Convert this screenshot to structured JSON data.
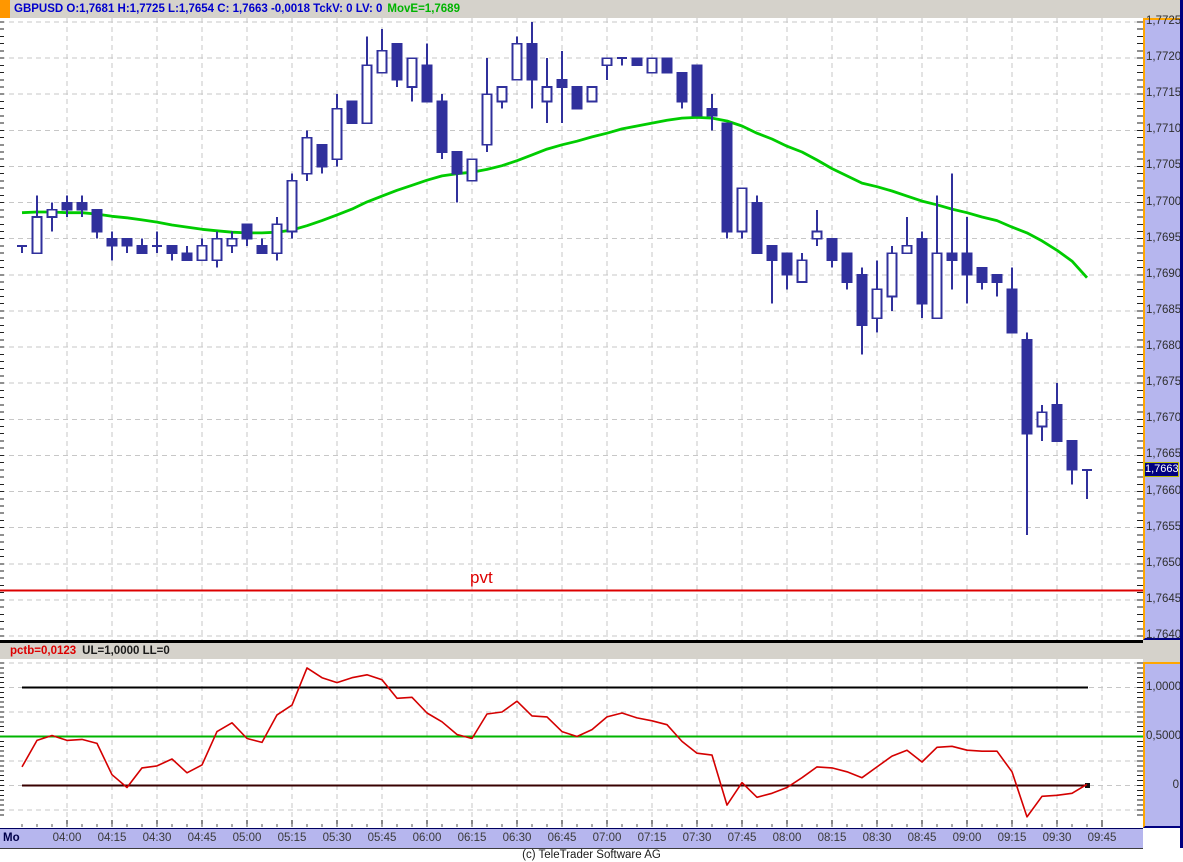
{
  "header": {
    "symbol_info": "GBPUSD O:1,7681 H:1,7725 L:1,7654 C: 1,7663 -0,0018 TckV: 0 LV: 0",
    "ma_info": "MovE=1,7689"
  },
  "price_axis": {
    "labels": [
      "1,7725",
      "1,7720",
      "1,7715",
      "1,7710",
      "1,7705",
      "1,7700",
      "1,7695",
      "1,7690",
      "1,7685",
      "1,7680",
      "1,7675",
      "1,7670",
      "1,7665",
      "1,7660",
      "1,7655",
      "1,7650",
      "1,7645",
      "1,7640"
    ],
    "current_price_tag": "1,7663"
  },
  "indicator": {
    "header_value": "pctb=0,0123",
    "header_params": "UL=1,0000 LL=0",
    "axis_labels": [
      "1,0000",
      "0,5000",
      "0"
    ],
    "axis_values": [
      1.0,
      0.5,
      0.0
    ]
  },
  "pvt_label": "pvt",
  "time_axis": {
    "day_label": "Mo",
    "labels": [
      "04:00",
      "04:15",
      "04:30",
      "04:45",
      "05:00",
      "05:15",
      "05:30",
      "05:45",
      "06:00",
      "06:15",
      "06:30",
      "06:45",
      "07:00",
      "07:15",
      "07:30",
      "07:45",
      "08:00",
      "08:15",
      "08:30",
      "08:45",
      "09:00",
      "09:15",
      "09:30",
      "09:45"
    ]
  },
  "footer": {
    "copyright": "(c) TeleTrader Software AG"
  },
  "colors": {
    "header_bg": "#d5d2cb",
    "header_text": "#0000cc",
    "ma_text": "#00b400",
    "axis_bg": "#b6b6ee",
    "axis_border_orange": "#ffa600",
    "window_border": "#000080",
    "grid": "#c7c7c7",
    "candle": "#30309c",
    "candle_up_fill": "#ffffff",
    "ma_line": "#00cc00",
    "pvt_line": "#dd0000",
    "oscillator": "#d40000",
    "upper_level": "#000000",
    "mid_level": "#00b400",
    "lower_level": "#380000",
    "price_tag_bg": "#000080",
    "price_tag_border": "#b8b800",
    "tick": "#222222"
  },
  "chart_data": [
    {
      "type": "candlestick",
      "title": "GBPUSD 5-minute candles with moving average (MovE) and pivot line",
      "ylim": [
        1.764,
        1.7727
      ],
      "y_tick_step": 0.0005,
      "grid": "dashed",
      "x": [
        "03:45",
        "03:50",
        "03:55",
        "04:00",
        "04:05",
        "04:10",
        "04:15",
        "04:20",
        "04:25",
        "04:30",
        "04:35",
        "04:40",
        "04:45",
        "04:50",
        "04:55",
        "05:00",
        "05:05",
        "05:10",
        "05:15",
        "05:20",
        "05:25",
        "05:30",
        "05:35",
        "05:40",
        "05:45",
        "05:50",
        "05:55",
        "06:00",
        "06:05",
        "06:10",
        "06:15",
        "06:20",
        "06:25",
        "06:30",
        "06:35",
        "06:40",
        "06:45",
        "06:50",
        "06:55",
        "07:00",
        "07:05",
        "07:10",
        "07:15",
        "07:20",
        "07:25",
        "07:30",
        "07:35",
        "07:40",
        "07:45",
        "07:50",
        "07:55",
        "08:00",
        "08:05",
        "08:10",
        "08:15",
        "08:20",
        "08:25",
        "08:30",
        "08:35",
        "08:40",
        "08:45",
        "08:50",
        "08:55",
        "09:00",
        "09:05",
        "09:10",
        "09:15",
        "09:20",
        "09:25",
        "09:30",
        "09:35",
        "09:40"
      ],
      "ohlc": [
        [
          1.7694,
          1.7694,
          1.7693,
          1.7694
        ],
        [
          1.7693,
          1.7701,
          1.7693,
          1.7698
        ],
        [
          1.7698,
          1.77,
          1.7696,
          1.7699
        ],
        [
          1.77,
          1.7701,
          1.7698,
          1.7699
        ],
        [
          1.77,
          1.7701,
          1.7698,
          1.7699
        ],
        [
          1.7699,
          1.7699,
          1.7695,
          1.7696
        ],
        [
          1.7695,
          1.7696,
          1.7692,
          1.7694
        ],
        [
          1.7695,
          1.7695,
          1.7693,
          1.7694
        ],
        [
          1.7694,
          1.7695,
          1.7693,
          1.7693
        ],
        [
          1.7694,
          1.7696,
          1.7693,
          1.7694
        ],
        [
          1.7694,
          1.7694,
          1.7692,
          1.7693
        ],
        [
          1.7693,
          1.7694,
          1.7692,
          1.7692
        ],
        [
          1.7692,
          1.7695,
          1.7692,
          1.7694
        ],
        [
          1.7692,
          1.7696,
          1.7691,
          1.7695
        ],
        [
          1.7694,
          1.7696,
          1.7693,
          1.7695
        ],
        [
          1.7697,
          1.7697,
          1.7694,
          1.7695
        ],
        [
          1.7694,
          1.7695,
          1.7693,
          1.7693
        ],
        [
          1.7693,
          1.7698,
          1.7692,
          1.7697
        ],
        [
          1.7696,
          1.7704,
          1.7695,
          1.7703
        ],
        [
          1.7704,
          1.771,
          1.7703,
          1.7709
        ],
        [
          1.7708,
          1.7708,
          1.7704,
          1.7705
        ],
        [
          1.7706,
          1.7715,
          1.7705,
          1.7713
        ],
        [
          1.7714,
          1.7714,
          1.7711,
          1.7711
        ],
        [
          1.7711,
          1.7723,
          1.7711,
          1.7719
        ],
        [
          1.7718,
          1.7724,
          1.7718,
          1.7721
        ],
        [
          1.7722,
          1.7722,
          1.7716,
          1.7717
        ],
        [
          1.7716,
          1.772,
          1.7714,
          1.772
        ],
        [
          1.7719,
          1.7722,
          1.7714,
          1.7714
        ],
        [
          1.7714,
          1.7715,
          1.7706,
          1.7707
        ],
        [
          1.7707,
          1.7707,
          1.77,
          1.7704
        ],
        [
          1.7703,
          1.7706,
          1.7703,
          1.7706
        ],
        [
          1.7708,
          1.772,
          1.7707,
          1.7715
        ],
        [
          1.7714,
          1.7716,
          1.7713,
          1.7716
        ],
        [
          1.7717,
          1.7723,
          1.7717,
          1.7722
        ],
        [
          1.7722,
          1.7725,
          1.7713,
          1.7717
        ],
        [
          1.7714,
          1.772,
          1.7711,
          1.7716
        ],
        [
          1.7717,
          1.7721,
          1.7711,
          1.7716
        ],
        [
          1.7716,
          1.7716,
          1.7713,
          1.7713
        ],
        [
          1.7714,
          1.7716,
          1.7714,
          1.7716
        ],
        [
          1.7719,
          1.772,
          1.7717,
          1.772
        ],
        [
          1.772,
          1.772,
          1.7719,
          1.772
        ],
        [
          1.772,
          1.772,
          1.7719,
          1.7719
        ],
        [
          1.7718,
          1.772,
          1.7718,
          1.772
        ],
        [
          1.772,
          1.772,
          1.7718,
          1.7718
        ],
        [
          1.7718,
          1.7718,
          1.7713,
          1.7714
        ],
        [
          1.7719,
          1.7719,
          1.7712,
          1.7712
        ],
        [
          1.7713,
          1.7715,
          1.771,
          1.7712
        ],
        [
          1.7711,
          1.7711,
          1.7695,
          1.7696
        ],
        [
          1.7696,
          1.7702,
          1.7695,
          1.7702
        ],
        [
          1.77,
          1.7701,
          1.7693,
          1.7693
        ],
        [
          1.7694,
          1.7694,
          1.7686,
          1.7692
        ],
        [
          1.7693,
          1.7693,
          1.7688,
          1.769
        ],
        [
          1.7689,
          1.7693,
          1.7689,
          1.7692
        ],
        [
          1.7695,
          1.7699,
          1.7694,
          1.7696
        ],
        [
          1.7695,
          1.7695,
          1.7691,
          1.7692
        ],
        [
          1.7693,
          1.7693,
          1.7688,
          1.7689
        ],
        [
          1.769,
          1.7691,
          1.7679,
          1.7683
        ],
        [
          1.7684,
          1.7692,
          1.7682,
          1.7688
        ],
        [
          1.7687,
          1.7694,
          1.7685,
          1.7693
        ],
        [
          1.7693,
          1.7698,
          1.7693,
          1.7694
        ],
        [
          1.7695,
          1.7696,
          1.7684,
          1.7686
        ],
        [
          1.7684,
          1.7701,
          1.7684,
          1.7693
        ],
        [
          1.7693,
          1.7704,
          1.7688,
          1.7692
        ],
        [
          1.7693,
          1.7698,
          1.7686,
          1.769
        ],
        [
          1.7691,
          1.7691,
          1.7688,
          1.7689
        ],
        [
          1.769,
          1.769,
          1.7687,
          1.7689
        ],
        [
          1.7688,
          1.7691,
          1.7682,
          1.7682
        ],
        [
          1.7681,
          1.7682,
          1.7654,
          1.7668
        ],
        [
          1.7669,
          1.7672,
          1.7667,
          1.7671
        ],
        [
          1.7672,
          1.7675,
          1.7667,
          1.7667
        ],
        [
          1.7667,
          1.7667,
          1.7661,
          1.7663
        ],
        [
          1.7663,
          1.7663,
          1.7659,
          1.7663
        ]
      ],
      "overlays": [
        {
          "name": "MovE",
          "type": "line",
          "color": "#00cc00",
          "last_value_label": "1,7689",
          "values": [
            1.76986,
            1.76987,
            1.76987,
            1.76986,
            1.76986,
            1.76984,
            1.76981,
            1.76979,
            1.76976,
            1.76973,
            1.76969,
            1.76966,
            1.76963,
            1.76961,
            1.76959,
            1.76958,
            1.76958,
            1.76959,
            1.76962,
            1.76968,
            1.76975,
            1.76983,
            1.76991,
            1.77001,
            1.77009,
            1.77017,
            1.77024,
            1.77031,
            1.77037,
            1.7704,
            1.77042,
            1.77046,
            1.77051,
            1.77058,
            1.77066,
            1.77074,
            1.7708,
            1.77085,
            1.77091,
            1.77096,
            1.77102,
            1.77106,
            1.7711,
            1.77114,
            1.77117,
            1.77118,
            1.77117,
            1.77113,
            1.77106,
            1.77096,
            1.77088,
            1.77078,
            1.7707,
            1.77059,
            1.77047,
            1.77037,
            1.77027,
            1.77022,
            1.77016,
            1.77009,
            1.77002,
            1.76997,
            1.76991,
            1.76986,
            1.7698,
            1.76975,
            1.76966,
            1.76958,
            1.76947,
            1.76934,
            1.76919,
            1.76896
          ]
        },
        {
          "name": "pvt",
          "type": "hline",
          "value": 1.76463,
          "color": "#dd0000"
        }
      ]
    },
    {
      "type": "line",
      "name": "pctb",
      "title": "pctb oscillator (percent-b), one value per 5-min candle 03:45-09:40",
      "ylim": [
        -0.35,
        1.29
      ],
      "levels": {
        "UL": 1.0,
        "mid": 0.5,
        "LL": 0.0
      },
      "last_value": 0.0123,
      "values": [
        0.19,
        0.46,
        0.51,
        0.46,
        0.47,
        0.43,
        0.11,
        -0.02,
        0.18,
        0.2,
        0.27,
        0.13,
        0.21,
        0.55,
        0.64,
        0.48,
        0.44,
        0.72,
        0.82,
        1.2,
        1.1,
        1.05,
        1.1,
        1.13,
        1.08,
        0.89,
        0.9,
        0.74,
        0.65,
        0.52,
        0.48,
        0.73,
        0.75,
        0.86,
        0.71,
        0.7,
        0.55,
        0.5,
        0.57,
        0.7,
        0.74,
        0.69,
        0.66,
        0.62,
        0.45,
        0.33,
        0.31,
        -0.2,
        0.03,
        -0.12,
        -0.08,
        -0.02,
        0.08,
        0.19,
        0.18,
        0.14,
        0.08,
        0.19,
        0.3,
        0.36,
        0.24,
        0.39,
        0.4,
        0.36,
        0.35,
        0.35,
        0.14,
        -0.32,
        -0.11,
        -0.1,
        -0.08,
        0.0123
      ]
    }
  ]
}
